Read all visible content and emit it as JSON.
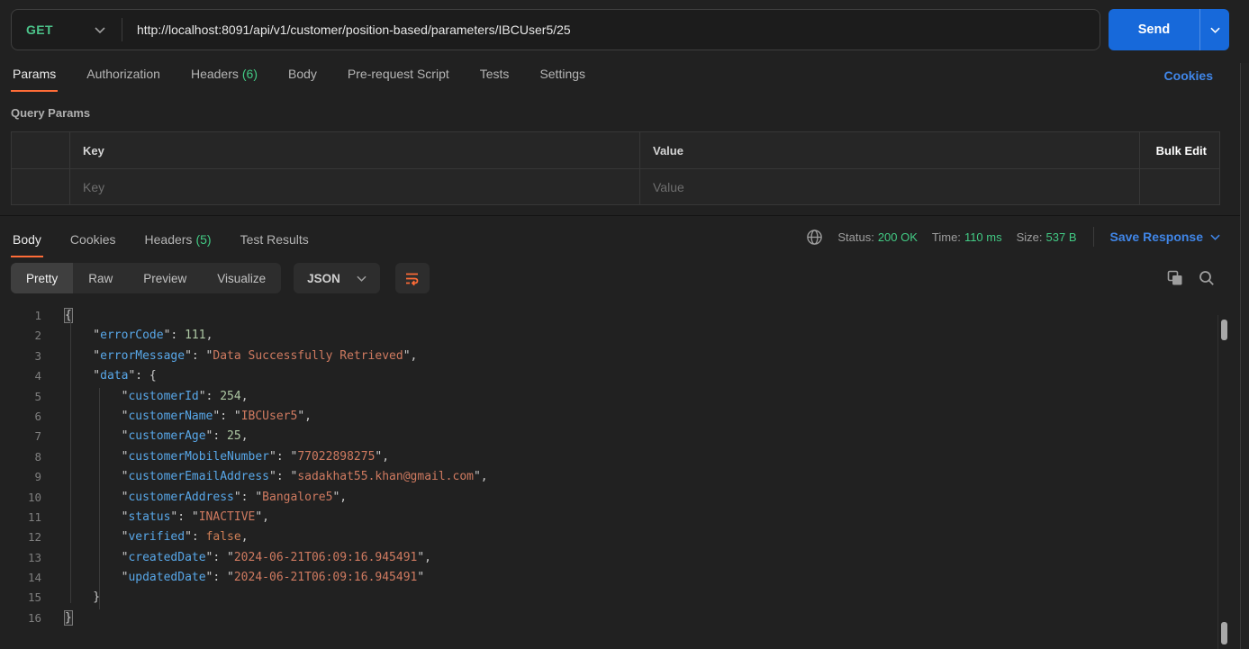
{
  "request": {
    "method": "GET",
    "url": "http://localhost:8091/api/v1/customer/position-based/parameters/IBCUser5/25",
    "send_label": "Send",
    "tabs": [
      {
        "label": "Params",
        "active": true
      },
      {
        "label": "Authorization"
      },
      {
        "label": "Headers",
        "count": "(6)"
      },
      {
        "label": "Body"
      },
      {
        "label": "Pre-request Script"
      },
      {
        "label": "Tests"
      },
      {
        "label": "Settings"
      }
    ],
    "cookies_link": "Cookies",
    "query_params": {
      "title": "Query Params",
      "key_header": "Key",
      "value_header": "Value",
      "bulk_edit": "Bulk Edit",
      "key_placeholder": "Key",
      "value_placeholder": "Value"
    }
  },
  "response": {
    "tabs": [
      {
        "label": "Body",
        "active": true
      },
      {
        "label": "Cookies"
      },
      {
        "label": "Headers",
        "count": "(5)"
      },
      {
        "label": "Test Results"
      }
    ],
    "meta": {
      "status_label": "Status:",
      "status_value": "200 OK",
      "time_label": "Time:",
      "time_value": "110 ms",
      "size_label": "Size:",
      "size_value": "537 B",
      "save_response": "Save Response"
    },
    "view_tabs": [
      {
        "label": "Pretty",
        "active": true
      },
      {
        "label": "Raw"
      },
      {
        "label": "Preview"
      },
      {
        "label": "Visualize"
      }
    ],
    "format": "JSON",
    "code": {
      "lines": [
        {
          "n": 1,
          "tokens": [
            [
              "mb",
              "{"
            ]
          ]
        },
        {
          "n": 2,
          "tokens": [
            [
              "p",
              "    \""
            ],
            [
              "k",
              "errorCode"
            ],
            [
              "p",
              "\": "
            ],
            [
              "n",
              "111"
            ],
            [
              "p",
              ","
            ]
          ]
        },
        {
          "n": 3,
          "tokens": [
            [
              "p",
              "    \""
            ],
            [
              "k",
              "errorMessage"
            ],
            [
              "p",
              "\": \""
            ],
            [
              "s",
              "Data Successfully Retrieved"
            ],
            [
              "p",
              "\","
            ]
          ]
        },
        {
          "n": 4,
          "tokens": [
            [
              "p",
              "    \""
            ],
            [
              "k",
              "data"
            ],
            [
              "p",
              "\": {"
            ]
          ]
        },
        {
          "n": 5,
          "tokens": [
            [
              "p",
              "        \""
            ],
            [
              "k",
              "customerId"
            ],
            [
              "p",
              "\": "
            ],
            [
              "n",
              "254"
            ],
            [
              "p",
              ","
            ]
          ]
        },
        {
          "n": 6,
          "tokens": [
            [
              "p",
              "        \""
            ],
            [
              "k",
              "customerName"
            ],
            [
              "p",
              "\": \""
            ],
            [
              "s",
              "IBCUser5"
            ],
            [
              "p",
              "\","
            ]
          ]
        },
        {
          "n": 7,
          "tokens": [
            [
              "p",
              "        \""
            ],
            [
              "k",
              "customerAge"
            ],
            [
              "p",
              "\": "
            ],
            [
              "n",
              "25"
            ],
            [
              "p",
              ","
            ]
          ]
        },
        {
          "n": 8,
          "tokens": [
            [
              "p",
              "        \""
            ],
            [
              "k",
              "customerMobileNumber"
            ],
            [
              "p",
              "\": \""
            ],
            [
              "s",
              "77022898275"
            ],
            [
              "p",
              "\","
            ]
          ]
        },
        {
          "n": 9,
          "tokens": [
            [
              "p",
              "        \""
            ],
            [
              "k",
              "customerEmailAddress"
            ],
            [
              "p",
              "\": \""
            ],
            [
              "s",
              "sadakhat55.khan@gmail.com"
            ],
            [
              "p",
              "\","
            ]
          ]
        },
        {
          "n": 10,
          "tokens": [
            [
              "p",
              "        \""
            ],
            [
              "k",
              "customerAddress"
            ],
            [
              "p",
              "\": \""
            ],
            [
              "s",
              "Bangalore5"
            ],
            [
              "p",
              "\","
            ]
          ]
        },
        {
          "n": 11,
          "tokens": [
            [
              "p",
              "        \""
            ],
            [
              "k",
              "status"
            ],
            [
              "p",
              "\": \""
            ],
            [
              "s",
              "INACTIVE"
            ],
            [
              "p",
              "\","
            ]
          ]
        },
        {
          "n": 12,
          "tokens": [
            [
              "p",
              "        \""
            ],
            [
              "k",
              "verified"
            ],
            [
              "p",
              "\": "
            ],
            [
              "b",
              "false"
            ],
            [
              "p",
              ","
            ]
          ]
        },
        {
          "n": 13,
          "tokens": [
            [
              "p",
              "        \""
            ],
            [
              "k",
              "createdDate"
            ],
            [
              "p",
              "\": \""
            ],
            [
              "s",
              "2024-06-21T06:09:16.945491"
            ],
            [
              "p",
              "\","
            ]
          ]
        },
        {
          "n": 14,
          "tokens": [
            [
              "p",
              "        \""
            ],
            [
              "k",
              "updatedDate"
            ],
            [
              "p",
              "\": \""
            ],
            [
              "s",
              "2024-06-21T06:09:16.945491"
            ],
            [
              "p",
              "\""
            ]
          ]
        },
        {
          "n": 15,
          "tokens": [
            [
              "p",
              "    }"
            ]
          ]
        },
        {
          "n": 16,
          "tokens": [
            [
              "mb",
              "}"
            ]
          ]
        }
      ]
    }
  },
  "colors": {
    "accent_orange": "#ff6c37",
    "method_green": "#4cc38a",
    "status_green": "#42ca84",
    "link_blue": "#4086e8",
    "send_blue": "#1769da"
  }
}
